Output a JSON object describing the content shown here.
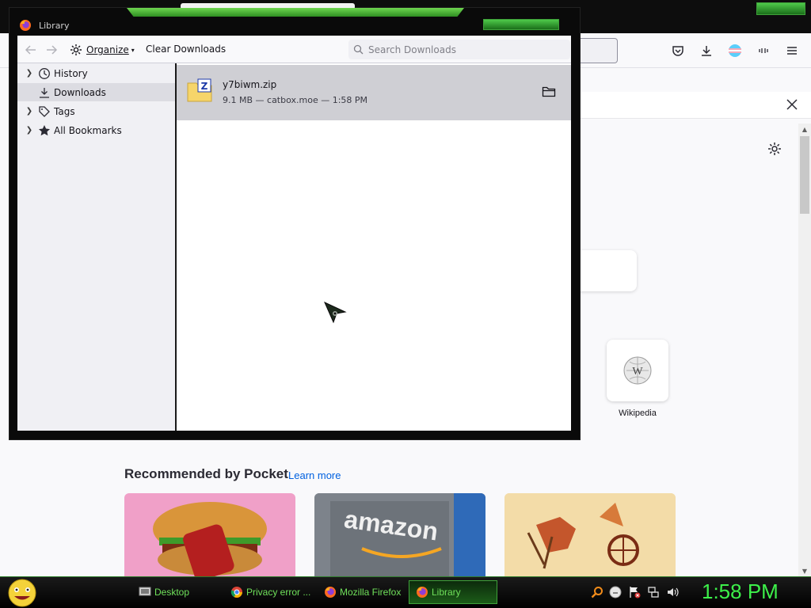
{
  "library": {
    "title": "Library",
    "toolbar": {
      "organize_label": "Organize",
      "clear_label": "Clear Downloads",
      "search_placeholder": "Search Downloads"
    },
    "sidebar": {
      "items": [
        {
          "label": "History",
          "icon": "clock-icon",
          "expandable": true
        },
        {
          "label": "Downloads",
          "icon": "download-icon",
          "expandable": false,
          "selected": true
        },
        {
          "label": "Tags",
          "icon": "tag-icon",
          "expandable": true
        },
        {
          "label": "All Bookmarks",
          "icon": "star-icon",
          "expandable": true
        }
      ]
    },
    "downloads": [
      {
        "filename": "y7biwm.zip",
        "status": "9.1 MB — catbox.moe — 1:58 PM",
        "icon": "zip-archive-icon"
      }
    ]
  },
  "firefox": {
    "pocket_title": "Recommended by Pocket",
    "pocket_link": "Learn more",
    "top_site_label": "Wikipedia"
  },
  "taskbar": {
    "buttons": [
      {
        "label": "Desktop",
        "icon": "desktop-icon"
      },
      {
        "label": "Privacy error ...",
        "icon": "chrome-icon"
      },
      {
        "label": "Mozilla Firefox",
        "icon": "firefox-icon"
      },
      {
        "label": "Library",
        "icon": "firefox-icon",
        "active": true
      }
    ],
    "clock": "1:58 PM"
  },
  "colors": {
    "accent_green": "#3df04a",
    "selection": "#cfcfd4",
    "link": "#0061e0"
  }
}
